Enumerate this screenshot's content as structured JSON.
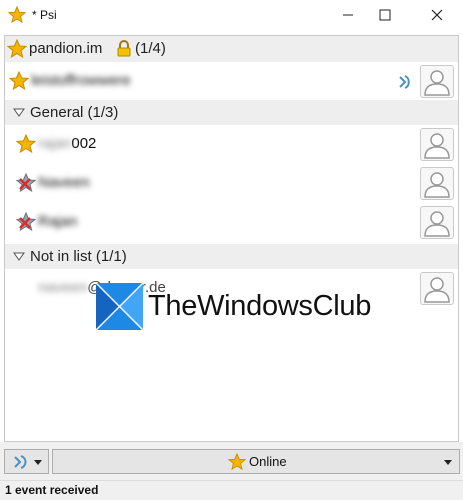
{
  "window": {
    "title": "* Psi",
    "minimize_icon": "minimize-icon",
    "maximize_icon": "maximize-icon",
    "close_icon": "close-icon"
  },
  "account": {
    "label": "pandion.im",
    "count": "(1/4)",
    "icon": "star-icon",
    "lock_icon": "lock-icon",
    "self_contact": {
      "name": "leistoffrowwere",
      "blurred": true,
      "client_icon": "psi-client-icon"
    }
  },
  "groups": [
    {
      "label": "General (1/3)",
      "contacts": [
        {
          "name_blurred_part": "rajan",
          "name_visible_part": "002",
          "status": "online"
        },
        {
          "name_blurred_part": "Naveen",
          "name_visible_part": "",
          "status": "offline"
        },
        {
          "name_blurred_part": "Rajan",
          "name_visible_part": "",
          "status": "offline"
        }
      ]
    },
    {
      "label": "Not in list (1/1)",
      "contacts": [
        {
          "name_blurred_part": "naveen",
          "name_visible_part": "@draugr.de",
          "status": "none"
        }
      ]
    }
  ],
  "watermark": {
    "text": "TheWindowsClub",
    "logo_color": "#1e88e5"
  },
  "bottom": {
    "menu_button_icon": "psi-menu-icon",
    "status_label": "Online",
    "status_icon": "star-icon",
    "status_dropdown_icon": "chevron-down-icon"
  },
  "statusbar": {
    "text": "1 event received"
  },
  "colors": {
    "star_fill": "#f5b400",
    "star_stroke": "#c98a00",
    "offline_x": "#d32f2f",
    "group_bg": "#eeeeee"
  }
}
